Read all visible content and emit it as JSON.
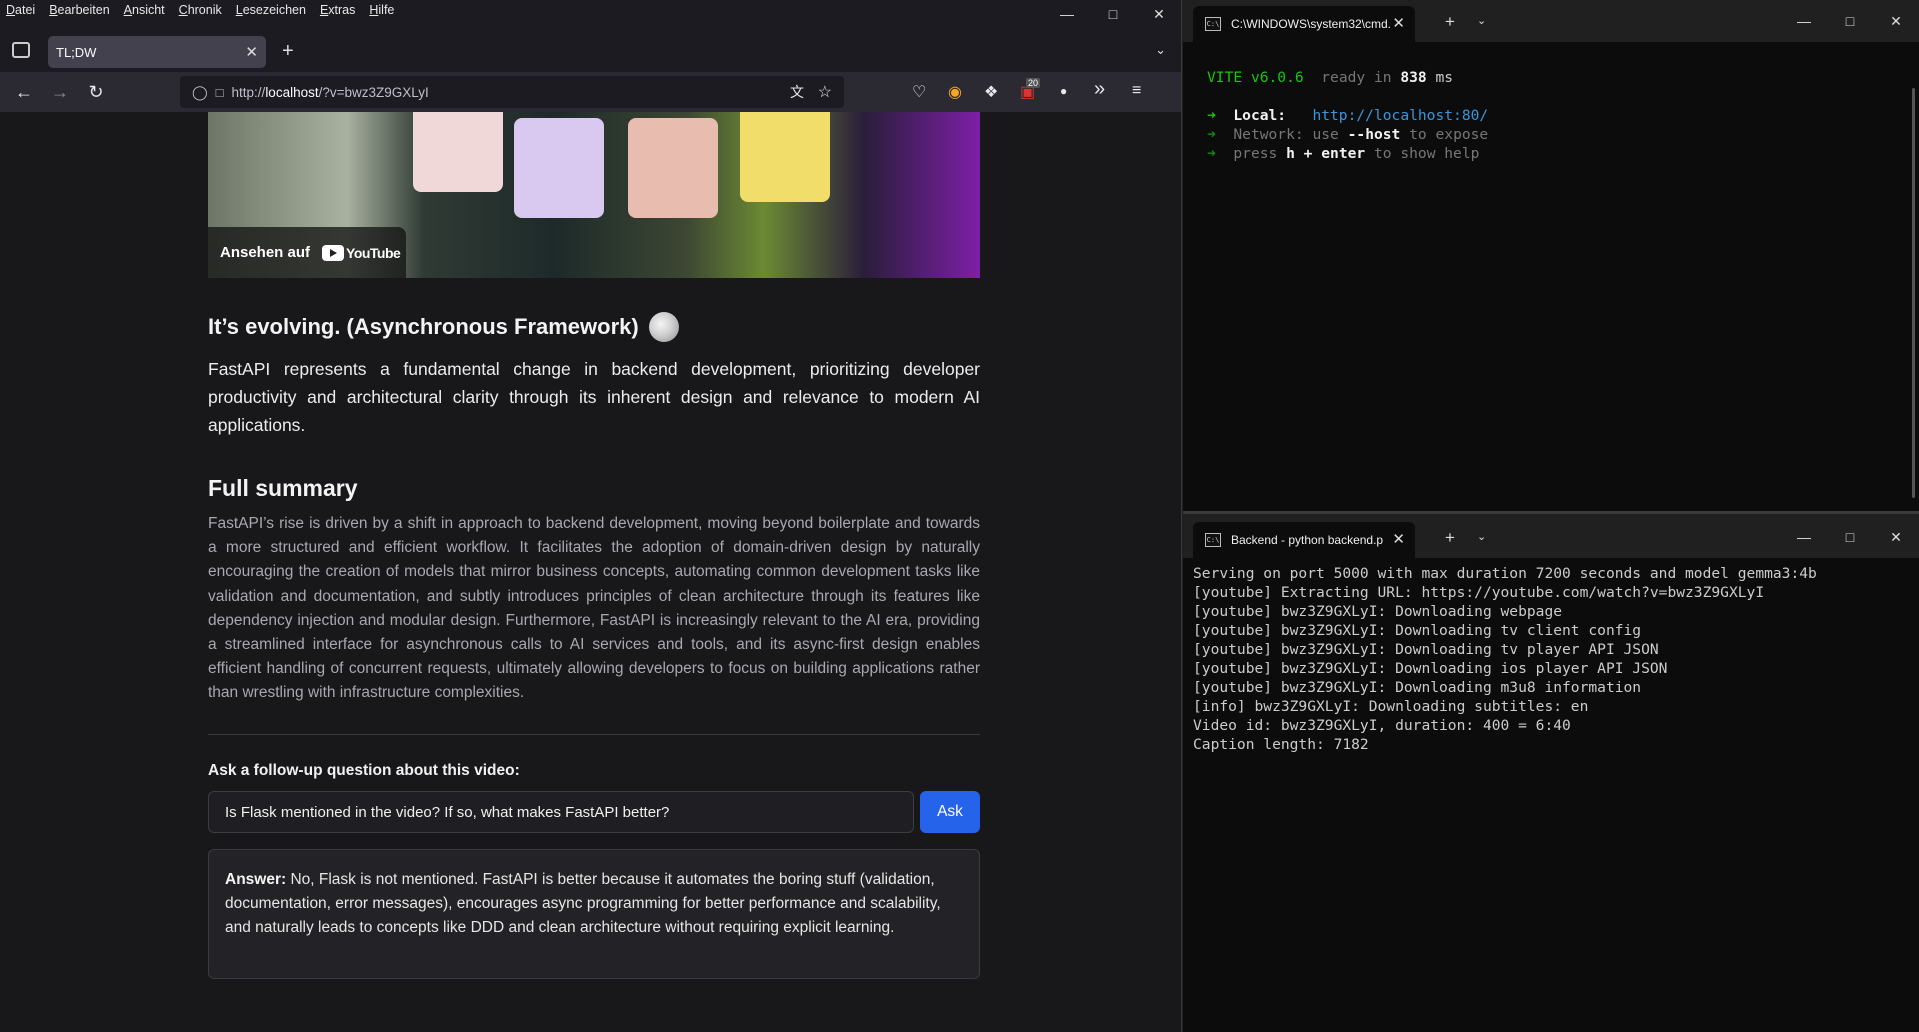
{
  "browser": {
    "menu": [
      "Datei",
      "Bearbeiten",
      "Ansicht",
      "Chronik",
      "Lesezeichen",
      "Extras",
      "Hilfe"
    ],
    "tab_title": "TL;DW",
    "url_prefix": "http://",
    "url_host": "localhost",
    "url_path": "/?v=bwz3Z9GXLyI",
    "extension_badge": "20"
  },
  "page": {
    "watch_on": "Ansehen auf",
    "youtube": "YouTube",
    "section_title": "It’s evolving. (Asynchronous Framework)",
    "section_body": "FastAPI represents a fundamental change in backend development, prioritizing developer productivity and architectural clarity through its inherent design and relevance to modern AI applications.",
    "summary_title": "Full summary",
    "summary_body": "FastAPI’s rise is driven by a shift in approach to backend development, moving beyond boilerplate and towards a more structured and efficient workflow. It facilitates the adoption of domain-driven design by naturally encouraging the creation of models that mirror business concepts, automating common development tasks like validation and documentation, and subtly introduces principles of clean architecture through its features like dependency injection and modular design. Furthermore, FastAPI is increasingly relevant to the AI era, providing a streamlined interface for asynchronous calls to AI services and tools, and its async-first design enables efficient handling of concurrent requests, ultimately allowing developers to focus on building applications rather than wrestling with infrastructure complexities.",
    "question_label": "Ask a follow-up question about this video:",
    "question_value": "Is Flask mentioned in the video? If so, what makes FastAPI better?",
    "ask_label": "Ask",
    "answer_label": "Answer:",
    "answer_text": "No, Flask is not mentioned. FastAPI is better because it automates the boring stuff (validation, documentation, error messages), encourages async programming for better performance and scalability, and naturally leads to concepts like DDD and clean architecture without requiring explicit learning."
  },
  "terminal1": {
    "tab_title": "C:\\WINDOWS\\system32\\cmd.",
    "vite_name": "VITE",
    "vite_version": "v6.0.6",
    "ready_text": "ready in",
    "ready_ms": "838",
    "ms": "ms",
    "local_label": "Local:",
    "local_url": "http://localhost:80/",
    "network_label": "Network:",
    "network_use": "use",
    "network_flag": "--host",
    "network_rest": "to expose",
    "press": "press",
    "press_keys": "h + enter",
    "press_rest": "to show help"
  },
  "terminal2": {
    "tab_title": "Backend - python  backend.p",
    "lines": [
      "Serving on port 5000 with max duration 7200 seconds and model gemma3:4b",
      "[youtube] Extracting URL: https://youtube.com/watch?v=bwz3Z9GXLyI",
      "[youtube] bwz3Z9GXLyI: Downloading webpage",
      "[youtube] bwz3Z9GXLyI: Downloading tv client config",
      "[youtube] bwz3Z9GXLyI: Downloading tv player API JSON",
      "[youtube] bwz3Z9GXLyI: Downloading ios player API JSON",
      "[youtube] bwz3Z9GXLyI: Downloading m3u8 information",
      "[info] bwz3Z9GXLyI: Downloading subtitles: en",
      "Video id: bwz3Z9GXLyI, duration: 400 = 6:40",
      "Caption length: 7182"
    ]
  }
}
